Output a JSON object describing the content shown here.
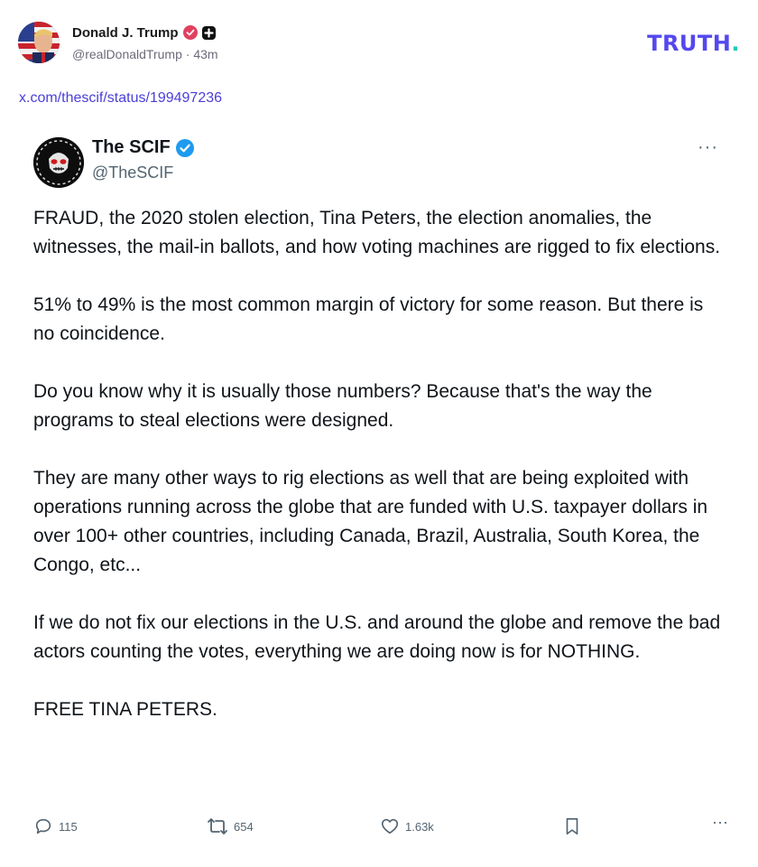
{
  "post": {
    "author_name": "Donald J. Trump",
    "author_handle": "@realDonaldTrump",
    "separator": "·",
    "time_ago": "43m",
    "link_text": "x.com/thescif/status/199497236"
  },
  "brand": {
    "logo_text": "TRUTH",
    "logo_dot": ".",
    "color_primary": "#5448ee",
    "color_dot": "#22c7b8"
  },
  "embed": {
    "name": "The SCIF",
    "handle": "@TheSCIF",
    "more": "···",
    "paragraphs": [
      "FRAUD, the 2020 stolen election, Tina Peters, the election anomalies, the witnesses, the mail-in ballots, and how voting machines are rigged to fix elections.",
      "51% to 49% is the most common margin of victory for some reason. But there is no coincidence.",
      "Do you know why it is usually those numbers? Because that's the way the programs to steal elections were designed.",
      "They are many other ways to rig elections as well that are being exploited with operations running across the globe that are funded with U.S. taxpayer dollars in over 100+ other countries, including Canada, Brazil, Australia, South Korea, the Congo, etc...",
      "If we do not fix our elections in the U.S. and around the globe and remove the bad actors counting the votes, everything we are doing now is for NOTHING.",
      "FREE TINA PETERS."
    ],
    "actions": {
      "replies": "115",
      "reposts": "654",
      "likes": "1.63k",
      "more": "···"
    },
    "verified_color": "#1d9bf0"
  },
  "icons": [
    "verified-badge-icon",
    "plus-badge-icon",
    "reply-icon",
    "repost-icon",
    "like-icon",
    "bookmark-icon",
    "more-icon"
  ]
}
